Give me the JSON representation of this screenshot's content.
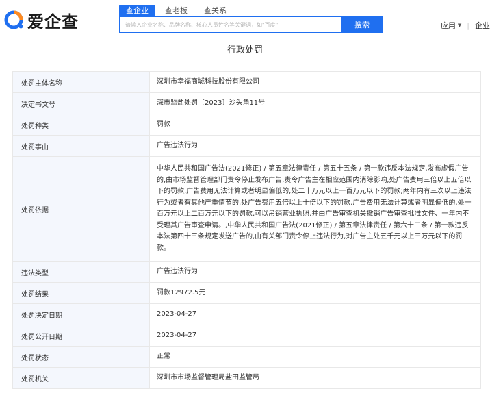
{
  "header": {
    "logo_text": "爱企查",
    "tabs": [
      "查企业",
      "查老板",
      "查关系"
    ],
    "search_placeholder": "请输入企业名称、品牌名称、核心人员姓名等关键词，如\"百度\"",
    "search_button": "搜索",
    "menu_apps": "应用",
    "menu_enterprise": "企业"
  },
  "page": {
    "title": "行政处罚"
  },
  "table": {
    "rows": [
      {
        "label": "处罚主体名称",
        "value": "深圳市幸福商城科技股份有限公司"
      },
      {
        "label": "决定书文号",
        "value": "深市监盐处罚〔2023〕沙头角11号"
      },
      {
        "label": "处罚种类",
        "value": "罚款"
      },
      {
        "label": "处罚事由",
        "value": "广告违法行为"
      },
      {
        "label": "处罚依据",
        "value": "中华人民共和国广告法(2021修正) / 第五章法律责任 / 第五十五条 / 第一款违反本法规定,发布虚假广告的,由市场监督管理部门责令停止发布广告,责令广告主在相应范围内消除影响,处广告费用三倍以上五倍以下的罚款,广告费用无法计算或者明显偏低的,处二十万元以上一百万元以下的罚款;两年内有三次以上违法行为或者有其他严重情节的,处广告费用五倍以上十倍以下的罚款,广告费用无法计算或者明显偏低的,处一百万元以上二百万元以下的罚款,可以吊销营业执照,并由广告审查机关撤销广告审查批准文件、一年内不受理其广告审查申请。,中华人民共和国广告法(2021修正) / 第五章法律责任 / 第六十二条 / 第一款违反本法第四十三条规定发送广告的,由有关部门责令停止违法行为,对广告主处五千元以上三万元以下的罚款。"
      },
      {
        "label": "违法类型",
        "value": "广告违法行为"
      },
      {
        "label": "处罚结果",
        "value": "罚款12972.5元"
      },
      {
        "label": "处罚决定日期",
        "value": "2023-04-27"
      },
      {
        "label": "处罚公开日期",
        "value": "2023-04-27"
      },
      {
        "label": "处罚状态",
        "value": "正常"
      },
      {
        "label": "处罚机关",
        "value": "深圳市市场监督管理局盐田监管局"
      }
    ]
  }
}
